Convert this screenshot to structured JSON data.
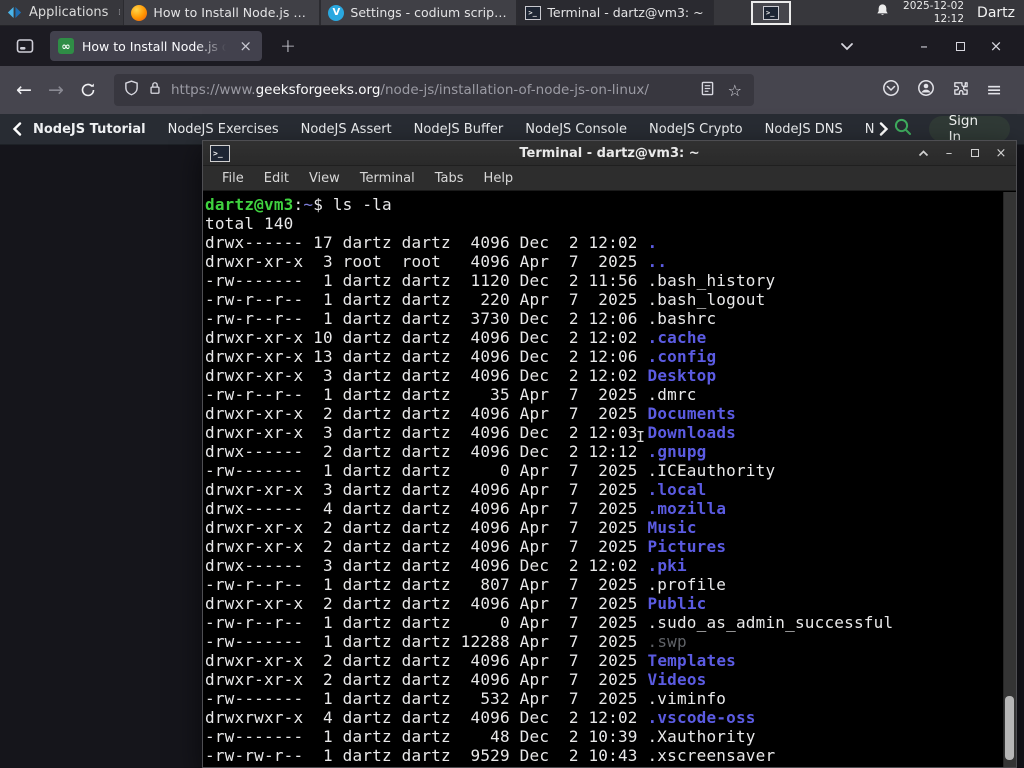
{
  "colors": {
    "gfg_green": "#2f8d46",
    "prompt_green": "#3fd23f",
    "directory_blue": "#5b5be2",
    "tab_active": "#42414d",
    "terminal_bg": "#000000"
  },
  "panel": {
    "applications": "Applications",
    "taskbar": [
      {
        "title": "How to Install Node.js o...",
        "icon": "firefox",
        "active": false
      },
      {
        "title": "Settings - codium script...",
        "icon": "vscodium",
        "active": false
      },
      {
        "title": "Terminal - dartz@vm3: ~",
        "icon": "terminal",
        "active": true
      }
    ],
    "clock": {
      "date": "2025-12-02",
      "time": "12:12"
    },
    "user": "Dartz"
  },
  "browser": {
    "tab_title": "How to Install Node.js on",
    "new_tab_label": "+",
    "url_prefix": "https://www.",
    "url_domain": "geeksforgeeks.org",
    "url_path": "/node-js/installation-of-node-js-on-linux/"
  },
  "site_nav": {
    "items": [
      "NodeJS Tutorial",
      "NodeJS Exercises",
      "NodeJS Assert",
      "NodeJS Buffer",
      "NodeJS Console",
      "NodeJS Crypto",
      "NodeJS DNS",
      "Node"
    ],
    "sign_in": "Sign In"
  },
  "terminal": {
    "title": "Terminal - dartz@vm3: ~",
    "menu": [
      "File",
      "Edit",
      "View",
      "Terminal",
      "Tabs",
      "Help"
    ],
    "lines": [
      [
        [
          "g",
          "dartz@vm3"
        ],
        [
          "p",
          ":"
        ],
        [
          "b",
          "~"
        ],
        [
          "p",
          "$ ls -la"
        ]
      ],
      [
        [
          "p",
          "total 140"
        ]
      ],
      [
        [
          "p",
          "drwx------ 17 dartz dartz  4096 Dec  2 12:02 "
        ],
        [
          "d",
          "."
        ]
      ],
      [
        [
          "p",
          "drwxr-xr-x  3 root  root   4096 Apr  7  2025 "
        ],
        [
          "d",
          ".."
        ]
      ],
      [
        [
          "p",
          "-rw-------  1 dartz dartz  1120 Dec  2 11:56 .bash_history"
        ]
      ],
      [
        [
          "p",
          "-rw-r--r--  1 dartz dartz   220 Apr  7  2025 .bash_logout"
        ]
      ],
      [
        [
          "p",
          "-rw-r--r--  1 dartz dartz  3730 Dec  2 12:06 .bashrc"
        ]
      ],
      [
        [
          "p",
          "drwxr-xr-x 10 dartz dartz  4096 Dec  2 12:02 "
        ],
        [
          "d",
          ".cache"
        ]
      ],
      [
        [
          "p",
          "drwxr-xr-x 13 dartz dartz  4096 Dec  2 12:06 "
        ],
        [
          "d",
          ".config"
        ]
      ],
      [
        [
          "p",
          "drwxr-xr-x  3 dartz dartz  4096 Dec  2 12:02 "
        ],
        [
          "d",
          "Desktop"
        ]
      ],
      [
        [
          "p",
          "-rw-r--r--  1 dartz dartz    35 Apr  7  2025 .dmrc"
        ]
      ],
      [
        [
          "p",
          "drwxr-xr-x  2 dartz dartz  4096 Apr  7  2025 "
        ],
        [
          "d",
          "Documents"
        ]
      ],
      [
        [
          "p",
          "drwxr-xr-x  3 dartz dartz  4096 Dec  2 12:03 "
        ],
        [
          "d",
          "Downloads"
        ]
      ],
      [
        [
          "p",
          "drwx------  2 dartz dartz  4096 Dec  2 12:12 "
        ],
        [
          "d",
          ".gnupg"
        ]
      ],
      [
        [
          "p",
          "-rw-------  1 dartz dartz     0 Apr  7  2025 .ICEauthority"
        ]
      ],
      [
        [
          "p",
          "drwxr-xr-x  3 dartz dartz  4096 Apr  7  2025 "
        ],
        [
          "d",
          ".local"
        ]
      ],
      [
        [
          "p",
          "drwx------  4 dartz dartz  4096 Apr  7  2025 "
        ],
        [
          "d",
          ".mozilla"
        ]
      ],
      [
        [
          "p",
          "drwxr-xr-x  2 dartz dartz  4096 Apr  7  2025 "
        ],
        [
          "d",
          "Music"
        ]
      ],
      [
        [
          "p",
          "drwxr-xr-x  2 dartz dartz  4096 Apr  7  2025 "
        ],
        [
          "d",
          "Pictures"
        ]
      ],
      [
        [
          "p",
          "drwx------  3 dartz dartz  4096 Dec  2 12:02 "
        ],
        [
          "d",
          ".pki"
        ]
      ],
      [
        [
          "p",
          "-rw-r--r--  1 dartz dartz   807 Apr  7  2025 .profile"
        ]
      ],
      [
        [
          "p",
          "drwxr-xr-x  2 dartz dartz  4096 Apr  7  2025 "
        ],
        [
          "d",
          "Public"
        ]
      ],
      [
        [
          "p",
          "-rw-r--r--  1 dartz dartz     0 Apr  7  2025 .sudo_as_admin_successful"
        ]
      ],
      [
        [
          "p",
          "-rw-------  1 dartz dartz 12288 Apr  7  2025 "
        ],
        [
          "dim",
          ".swp"
        ]
      ],
      [
        [
          "p",
          "drwxr-xr-x  2 dartz dartz  4096 Apr  7  2025 "
        ],
        [
          "d",
          "Templates"
        ]
      ],
      [
        [
          "p",
          "drwxr-xr-x  2 dartz dartz  4096 Apr  7  2025 "
        ],
        [
          "d",
          "Videos"
        ]
      ],
      [
        [
          "p",
          "-rw-------  1 dartz dartz   532 Apr  7  2025 .viminfo"
        ]
      ],
      [
        [
          "p",
          "drwxrwxr-x  4 dartz dartz  4096 Dec  2 12:02 "
        ],
        [
          "d",
          ".vscode-oss"
        ]
      ],
      [
        [
          "p",
          "-rw-------  1 dartz dartz    48 Dec  2 10:39 .Xauthority"
        ]
      ],
      [
        [
          "p",
          "-rw-rw-r--  1 dartz dartz  9529 Dec  2 10:43 .xscreensaver"
        ]
      ]
    ]
  }
}
